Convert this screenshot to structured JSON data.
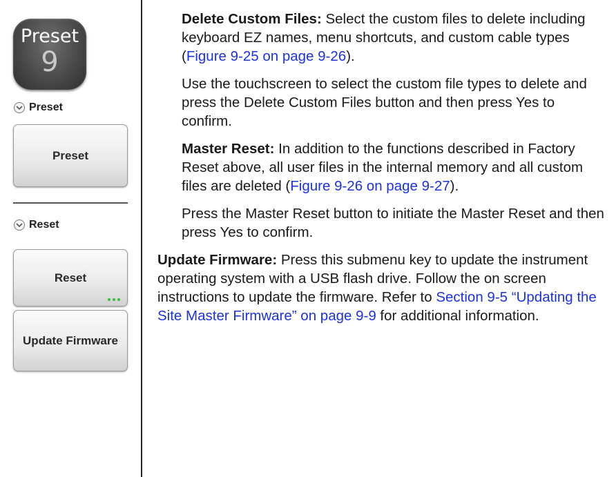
{
  "sidebar": {
    "hardkey": {
      "label": "Preset",
      "number": "9"
    },
    "menus": [
      {
        "header": "Preset",
        "buttons": [
          {
            "label": "Preset"
          }
        ]
      },
      {
        "header": "Reset",
        "buttons": [
          {
            "label": "Reset",
            "has_submenu_dots": true
          },
          {
            "label": "Update Firmware"
          }
        ]
      }
    ],
    "colors": {
      "hardkey_bg": "#4a4a4a",
      "submenu_dots": "#3bbf3b",
      "link": "#1a33e0"
    }
  },
  "content": {
    "delete_custom": {
      "term": "Delete Custom Files:",
      "text": " Select the custom files to delete including keyboard EZ names, menu shortcuts, and custom cable types (",
      "link": "Figure 9-25 on page 9-26",
      "tail": ")."
    },
    "delete_custom_instructions": "Use the touchscreen to select the custom file types to delete and press the Delete Custom Files button and then press Yes to confirm.",
    "master_reset": {
      "term": "Master Reset:",
      "text": " In addition to the functions described in Factory Reset above, all user files in the internal memory and all custom files are deleted (",
      "link": "Figure 9-26 on page 9-27",
      "tail": ")."
    },
    "master_reset_instructions": "Press the Master Reset button to initiate the Master Reset and then press Yes to confirm.",
    "update_firmware": {
      "term": "Update Firmware:",
      "text": "  Press this submenu key to update the instrument operating system with a USB flash drive. Follow the on screen instructions to update the firmware. Refer to ",
      "link": "Section 9-5 “Updating the Site Master Firmware” on page 9-9",
      "tail": " for additional information."
    }
  }
}
